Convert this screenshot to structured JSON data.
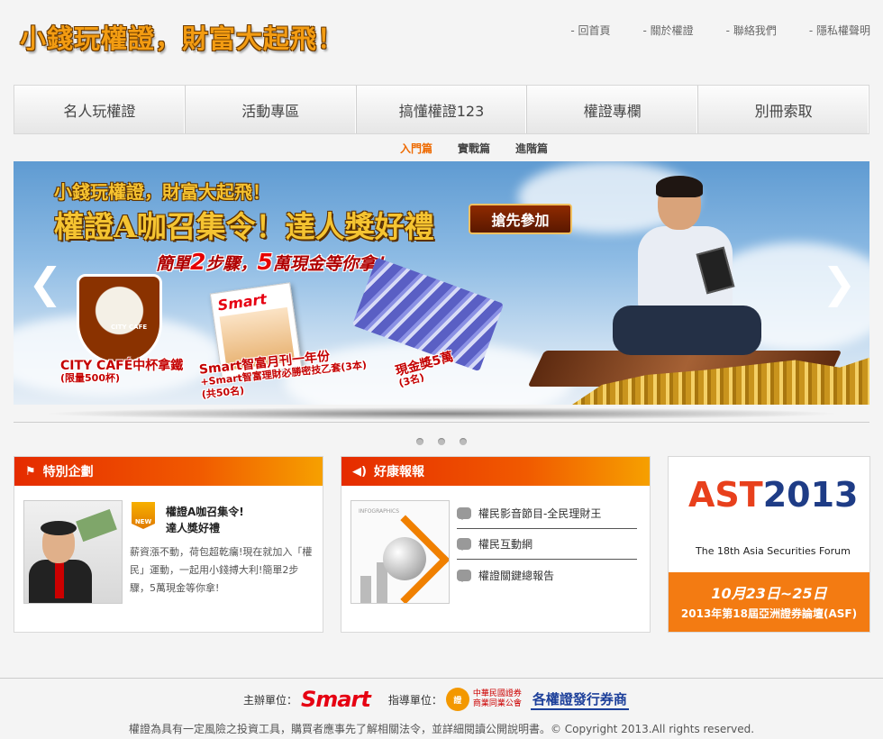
{
  "header": {
    "logo": "小錢玩權證，財富大起飛！",
    "links": [
      "回首頁",
      "關於權證",
      "聯絡我們",
      "隱私權聲明"
    ]
  },
  "nav": {
    "items": [
      "名人玩權證",
      "活動專區",
      "搞懂權證123",
      "權證專欄",
      "別冊索取"
    ],
    "sub": [
      "入門篇",
      "實戰篇",
      "進階篇"
    ],
    "sub_active": "入門篇"
  },
  "banner": {
    "title_small": "小錢玩權證，財富大起飛！",
    "title_big": "權證A咖召集令！達人獎好禮",
    "cta": "搶先參加",
    "steps_pre": "簡單",
    "steps_num": "2",
    "steps_mid": "步驟，",
    "steps_num2": "5",
    "steps_post": "萬現金等你拿！",
    "prize1": "CITY CAFÉ中杯拿鐵",
    "prize1_qty": "(限量500杯)",
    "prize2": "Smart智富月刊一年份",
    "prize2_b": "+Smart智富理財必勝密技乙套(3本)",
    "prize2_qty": "(共50名)",
    "prize3": "現金獎5萬",
    "prize3_qty": "(3名)",
    "cup_logo": "CITY CAFE",
    "mag_logo": "Smart",
    "prev": "❮",
    "next": "❯"
  },
  "special": {
    "heading": "特別企劃",
    "badge": "NEW",
    "title1": "權證A咖召集令!",
    "title2": "達人獎好禮",
    "desc": "薪資漲不動，荷包超乾癟!現在就加入「權民」運動，一起用小錢搏大利!簡單2步驟，5萬現金等你拿!"
  },
  "news": {
    "heading": "好康報報",
    "thumb_label": "INFOGRAPHICS",
    "items": [
      "權民影音節目-全民理財王",
      "權民互動網",
      "權證關鍵總報告"
    ]
  },
  "asf": {
    "logo_a": "AS",
    "logo_b": "T",
    "logo_year": "2013",
    "subtitle": "The 18th Asia Securities Forum",
    "date": "10月23日~25日",
    "name": "2013年第18屆亞洲證券論壇(ASF)"
  },
  "footer": {
    "host_label": "主辦單位：",
    "host": "Smart",
    "guide_label": "指導單位：",
    "assoc_line1": "中華民國證券",
    "assoc_line2": "商業同業公會",
    "issuers": "各權證發行券商",
    "copyright": "權證為具有一定風險之投資工具，購買者應事先了解相關法令，並詳細閱讀公開說明書。© Copyright 2013.All rights reserved."
  }
}
